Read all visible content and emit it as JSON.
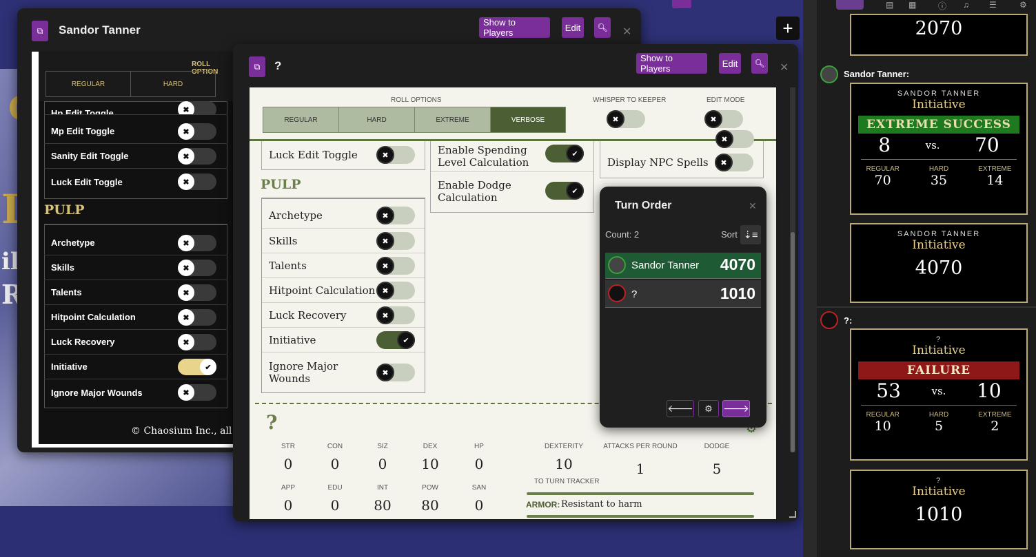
{
  "back_window": {
    "title": "Sandor Tanner",
    "show_to_players": "Show to Players",
    "edit": "Edit",
    "roll_options_label": "ROLL OPTION",
    "roll_buttons": [
      "REGULAR",
      "HARD"
    ],
    "toggles": [
      {
        "label": "Hp Edit Toggle",
        "on": false
      },
      {
        "label": "Mp Edit Toggle",
        "on": false
      },
      {
        "label": "Sanity Edit Toggle",
        "on": false
      },
      {
        "label": "Luck Edit Toggle",
        "on": false
      }
    ],
    "pulp_heading": "PULP",
    "pulp_toggles": [
      {
        "label": "Archetype",
        "on": false
      },
      {
        "label": "Skills",
        "on": false
      },
      {
        "label": "Talents",
        "on": false
      },
      {
        "label": "Hitpoint Calculation",
        "on": false
      },
      {
        "label": "Luck Recovery",
        "on": false
      },
      {
        "label": "Initiative",
        "on": true
      },
      {
        "label": "Ignore Major Wounds",
        "on": false
      }
    ],
    "copyright": "© Chaosium Inc., all ri"
  },
  "front_window": {
    "title": "?",
    "show_to_players": "Show to Players",
    "edit": "Edit",
    "roll_options_label": "ROLL OPTIONS",
    "roll_buttons": [
      "REGULAR",
      "HARD",
      "EXTREME",
      "VERBOSE"
    ],
    "whisper_label": "WHISPER TO KEEPER",
    "edit_mode_label": "EDIT MODE",
    "luck_edit_toggle": "Luck Edit Toggle",
    "pulp_heading": "PULP",
    "pulp_toggles": [
      {
        "label": "Archetype",
        "on": false
      },
      {
        "label": "Skills",
        "on": false
      },
      {
        "label": "Talents",
        "on": false
      },
      {
        "label": "Hitpoint Calculation",
        "on": false
      },
      {
        "label": "Luck Recovery",
        "on": false
      },
      {
        "label": "Initiative",
        "on": true
      },
      {
        "label": "Ignore Major Wounds",
        "on": false
      }
    ],
    "middle_toggles": [
      {
        "label": "Enable Spending Level Calculation",
        "on": true
      },
      {
        "label": "Enable Dodge Calculation",
        "on": true
      }
    ],
    "display_npc_spells": "Display NPC Spells",
    "npc_name": "?",
    "stats_row1": [
      {
        "label": "STR",
        "value": "0"
      },
      {
        "label": "CON",
        "value": "0"
      },
      {
        "label": "SIZ",
        "value": "0"
      },
      {
        "label": "DEX",
        "value": "10"
      },
      {
        "label": "HP",
        "value": "0"
      }
    ],
    "stats_row2": [
      {
        "label": "APP",
        "value": "0"
      },
      {
        "label": "EDU",
        "value": "0"
      },
      {
        "label": "INT",
        "value": "80"
      },
      {
        "label": "POW",
        "value": "80"
      },
      {
        "label": "SAN",
        "value": "0"
      }
    ],
    "combat": [
      {
        "label": "DEXTERITY",
        "value": "10"
      },
      {
        "label": "ATTACKS PER ROUND",
        "value": "1"
      },
      {
        "label": "DODGE",
        "value": "5"
      }
    ],
    "to_turn_tracker": "TO TURN TRACKER",
    "armor_label": "ARMOR:",
    "armor_value": "Resistant to harm"
  },
  "turn_order": {
    "title": "Turn Order",
    "count": "Count: 2",
    "sort": "Sort",
    "entries": [
      {
        "name": "Sandor Tanner",
        "value": "4070"
      },
      {
        "name": "?",
        "value": "1010"
      }
    ]
  },
  "chat": {
    "cards": [
      {
        "big": "2070"
      },
      {
        "speaker": "Sandor Tanner:",
        "who": "SANDOR TANNER",
        "title": "Initiative",
        "result": "EXTREME SUCCESS",
        "roll": "8",
        "vs": "vs.",
        "target": "70",
        "thresholds": [
          {
            "l": "REGULAR",
            "v": "70"
          },
          {
            "l": "HARD",
            "v": "35"
          },
          {
            "l": "EXTREME",
            "v": "14"
          }
        ]
      },
      {
        "who": "SANDOR TANNER",
        "title": "Initiative",
        "big": "4070"
      },
      {
        "speaker": "?:",
        "who": "?",
        "title": "Initiative",
        "result": "FAILURE",
        "roll": "53",
        "vs": "vs.",
        "target": "10",
        "thresholds": [
          {
            "l": "REGULAR",
            "v": "10"
          },
          {
            "l": "HARD",
            "v": "5"
          },
          {
            "l": "EXTREME",
            "v": "2"
          }
        ]
      },
      {
        "who": "?",
        "title": "Initiative",
        "big": "1010"
      }
    ]
  },
  "colors": {
    "accent": "#7a2e99",
    "success": "#1f7a1f",
    "failure": "#8e1717",
    "pulp_green": "#4b5e34"
  }
}
